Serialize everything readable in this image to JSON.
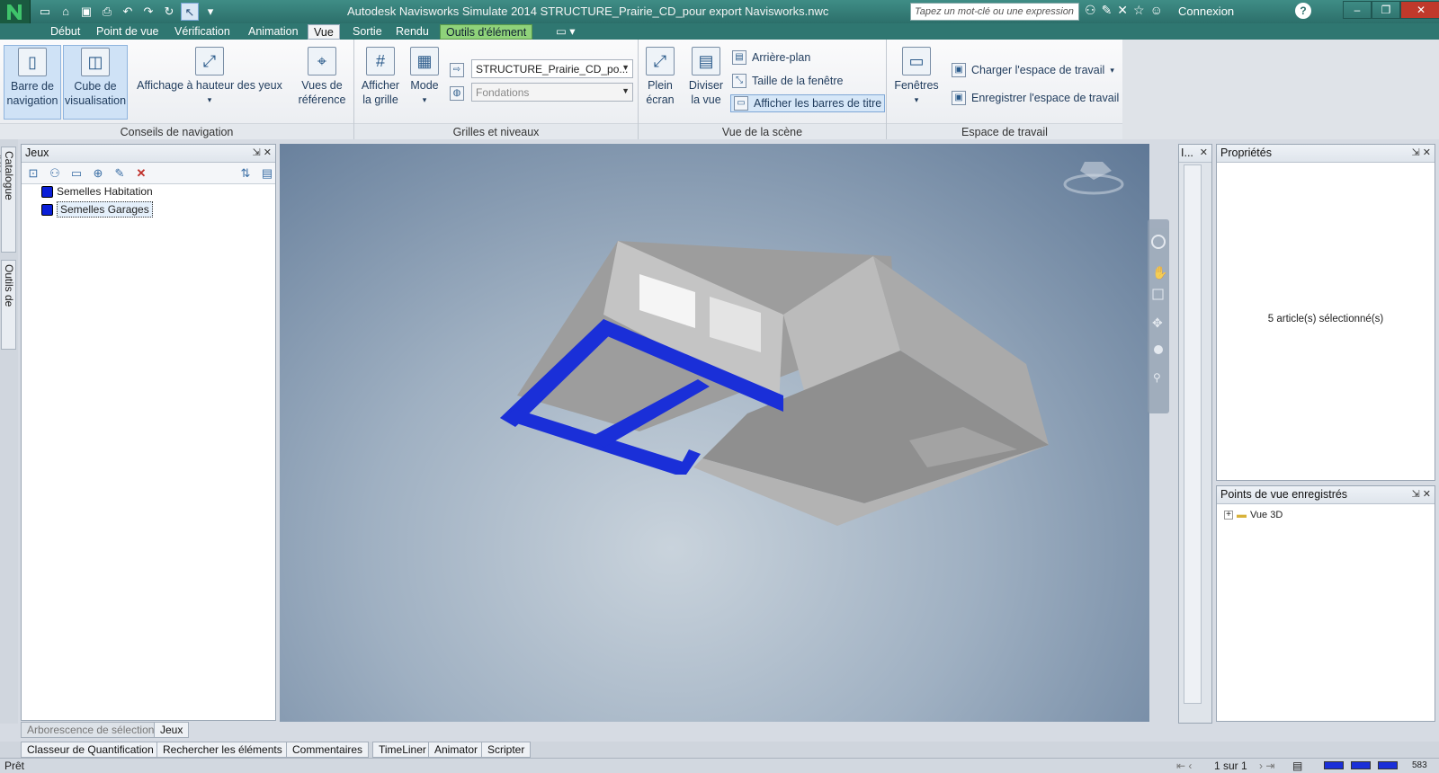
{
  "titlebar": {
    "title": "Autodesk Navisworks Simulate 2014     STRUCTURE_Prairie_CD_pour export Navisworks.nwc",
    "search_placeholder": "Tapez un mot-clé ou une expression",
    "connexion": "Connexion",
    "help": "?"
  },
  "menu": [
    "Début",
    "Point de vue",
    "Vérification",
    "Animation",
    "Vue",
    "Sortie",
    "Rendu",
    "Outils d'élément"
  ],
  "ribbon": {
    "nav": {
      "barre": "Barre de navigation",
      "cube": "Cube de visualisation",
      "hud": "Affichage à hauteur des yeux",
      "ref": "Vues de référence",
      "title": "Conseils de navigation"
    },
    "grids": {
      "afficher": "Afficher la grille",
      "mode": "Mode",
      "combo1": "STRUCTURE_Prairie_CD_po...",
      "combo2": "Fondations",
      "title": "Grilles et niveaux"
    },
    "scene": {
      "plein": "Plein écran",
      "diviser": "Diviser la vue",
      "arriere": "Arrière-plan",
      "taille": "Taille de la fenêtre",
      "barres": "Afficher les barres de titre",
      "title": "Vue de la scène"
    },
    "workspace": {
      "fenetres": "Fenêtres",
      "charger": "Charger l'espace de travail",
      "enregistrer": "Enregistrer l'espace de travail",
      "title": "Espace de travail"
    }
  },
  "left_vtabs": [
    "Catalogue d'éléments",
    "Outils de mesure"
  ],
  "sets_pane": {
    "title": "Jeux",
    "items": [
      "Semelles Habitation",
      "Semelles Garages"
    ],
    "tabs": [
      "Arborescence de sélection",
      "Jeux"
    ]
  },
  "thin_pane_title": "I...",
  "properties": {
    "title": "Propriétés",
    "selection_text": "5 article(s) sélectionné(s)"
  },
  "saved_views": {
    "title": "Points de vue enregistrés",
    "items": [
      "Vue 3D"
    ]
  },
  "bottom_tabs": [
    "Classeur de Quantification",
    "Rechercher les éléments",
    "Commentaires",
    "TimeLiner",
    "Animator",
    "Scripter"
  ],
  "status": {
    "ready": "Prêt",
    "page": "1 sur 1",
    "memory": "583"
  },
  "colors": {
    "selection": "#1a2fd8",
    "model": "#b9b9b9",
    "titlebar": "#2f7771"
  }
}
